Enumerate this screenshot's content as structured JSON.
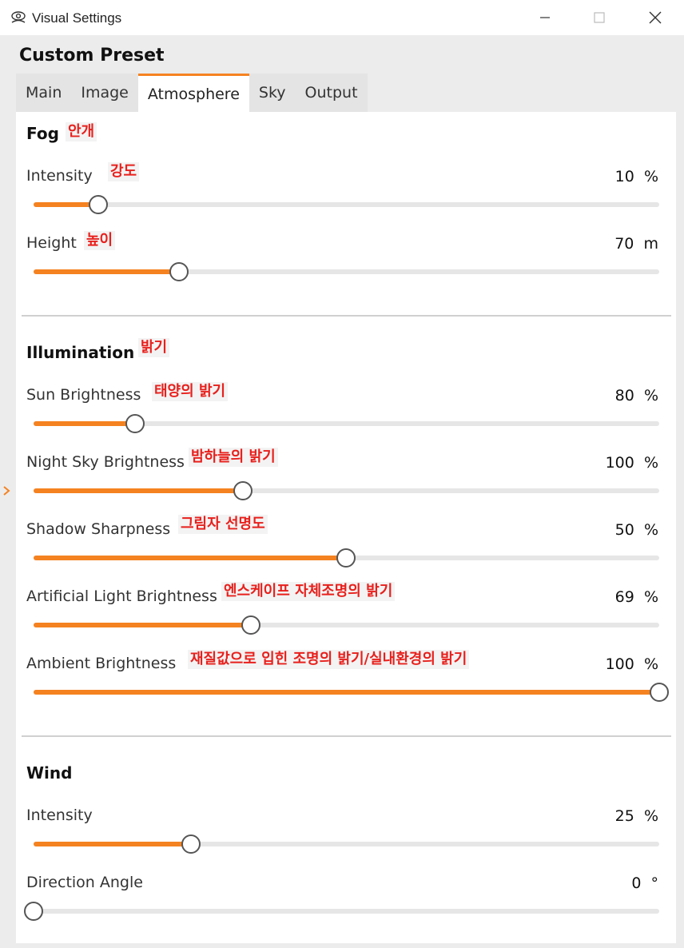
{
  "window": {
    "title": "Visual Settings",
    "icon": "eye-icon",
    "controls": [
      "minimize-icon",
      "maximize-icon",
      "close-icon"
    ]
  },
  "preset_title": "Custom Preset",
  "tabs": [
    {
      "label": "Main",
      "active": false
    },
    {
      "label": "Image",
      "active": false
    },
    {
      "label": "Atmosphere",
      "active": true
    },
    {
      "label": "Sky",
      "active": false
    },
    {
      "label": "Output",
      "active": false
    }
  ],
  "accent_color": "#f58220",
  "annotation_color": "#e8201c",
  "sections": {
    "fog": {
      "title": "Fog",
      "annotation": "안개",
      "intensity": {
        "label": "Intensity",
        "annotation": "강도",
        "value": "10",
        "unit": "%",
        "fraction": 0.104
      },
      "height": {
        "label": "Height",
        "annotation": "높이",
        "value": "70",
        "unit": "m",
        "fraction": 0.233
      }
    },
    "illumination": {
      "title": "Illumination",
      "annotation": "밝기",
      "sun": {
        "label": "Sun Brightness",
        "annotation": "태양의 밝기",
        "value": "80",
        "unit": "%",
        "fraction": 0.162
      },
      "night_sky": {
        "label": "Night Sky Brightness",
        "annotation": "밤하늘의 밝기",
        "value": "100",
        "unit": "%",
        "fraction": 0.334
      },
      "shadow": {
        "label": "Shadow Sharpness",
        "annotation": "그림자 선명도",
        "value": "50",
        "unit": "%",
        "fraction": 0.499
      },
      "artificial": {
        "label": "Artificial Light Brightness",
        "annotation": "엔스케이프 자체조명의 밝기",
        "value": "69",
        "unit": "%",
        "fraction": 0.347
      },
      "ambient": {
        "label": "Ambient Brightness",
        "annotation": "재질값으로 입힌 조명의 밝기/실내환경의 밝기",
        "value": "100",
        "unit": "%",
        "fraction": 1.0
      }
    },
    "wind": {
      "title": "Wind",
      "intensity": {
        "label": "Intensity",
        "value": "25",
        "unit": "%",
        "fraction": 0.251
      },
      "direction": {
        "label": "Direction Angle",
        "value": "0",
        "unit": "°",
        "fraction": 0.0
      }
    }
  }
}
